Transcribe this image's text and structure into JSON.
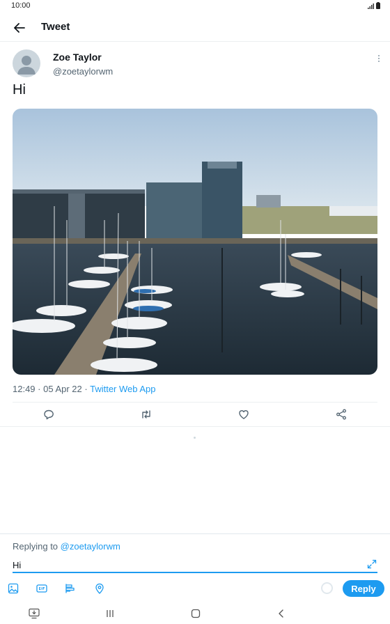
{
  "status_bar": {
    "time": "10:00"
  },
  "app_bar": {
    "title": "Tweet"
  },
  "tweet": {
    "author_name": "Zoe Taylor",
    "author_handle": "@zoetaylorwm",
    "text": "Hi",
    "time": "12:49",
    "separator": " · ",
    "date": "05 Apr 22",
    "source": "Twitter Web App"
  },
  "actions": [
    "reply-icon",
    "retweet-icon",
    "like-icon",
    "share-icon"
  ],
  "reply": {
    "replying_prefix": "Replying to",
    "replying_handle": "@zoetaylorwm",
    "input_value": "Hi",
    "button_label": "Reply"
  },
  "compose_tools": [
    "image-icon",
    "gif-icon",
    "poll-icon",
    "location-icon"
  ],
  "colors": {
    "accent": "#1d9bf0",
    "secondary_text": "#536471"
  }
}
